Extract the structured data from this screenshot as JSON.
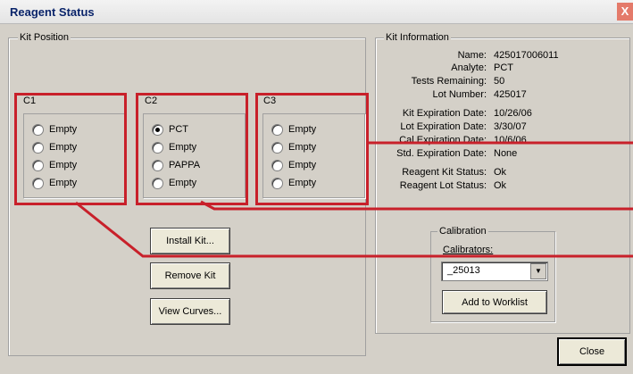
{
  "window": {
    "title": "Reagent Status",
    "close_glyph": "X"
  },
  "kit_position": {
    "legend": "Kit Position",
    "columns": [
      {
        "label": "C1",
        "options": [
          "Empty",
          "Empty",
          "Empty",
          "Empty"
        ],
        "selected": -1
      },
      {
        "label": "C2",
        "options": [
          "PCT",
          "Empty",
          "PAPPA",
          "Empty"
        ],
        "selected": 0
      },
      {
        "label": "C3",
        "options": [
          "Empty",
          "Empty",
          "Empty",
          "Empty"
        ],
        "selected": -1
      }
    ]
  },
  "buttons": {
    "install": "Install Kit...",
    "remove": "Remove Kit",
    "view": "View Curves...",
    "add": "Add to Worklist",
    "close": "Close"
  },
  "kit_info": {
    "legend": "Kit Information",
    "rows": [
      {
        "label": "Name:",
        "value": "425017006011"
      },
      {
        "label": "Analyte:",
        "value": "PCT"
      },
      {
        "label": "Tests Remaining:",
        "value": "50"
      },
      {
        "label": "Lot Number:",
        "value": "425017"
      },
      {
        "label": "Kit Expiration Date:",
        "value": "10/26/06"
      },
      {
        "label": "Lot Expiration Date:",
        "value": "3/30/07"
      },
      {
        "label": "Cal Expiration Date:",
        "value": "10/6/06"
      },
      {
        "label": "Std. Expiration Date:",
        "value": "None"
      },
      {
        "label": "Reagent Kit Status:",
        "value": "Ok"
      },
      {
        "label": "Reagent Lot Status:",
        "value": "Ok"
      }
    ]
  },
  "calibration": {
    "legend": "Calibration",
    "calibrators_label": "Calibrators:",
    "selected": "_25013"
  },
  "colors": {
    "highlight": "#c8202a",
    "title": "#0a246a",
    "face": "#d4d0c8"
  }
}
